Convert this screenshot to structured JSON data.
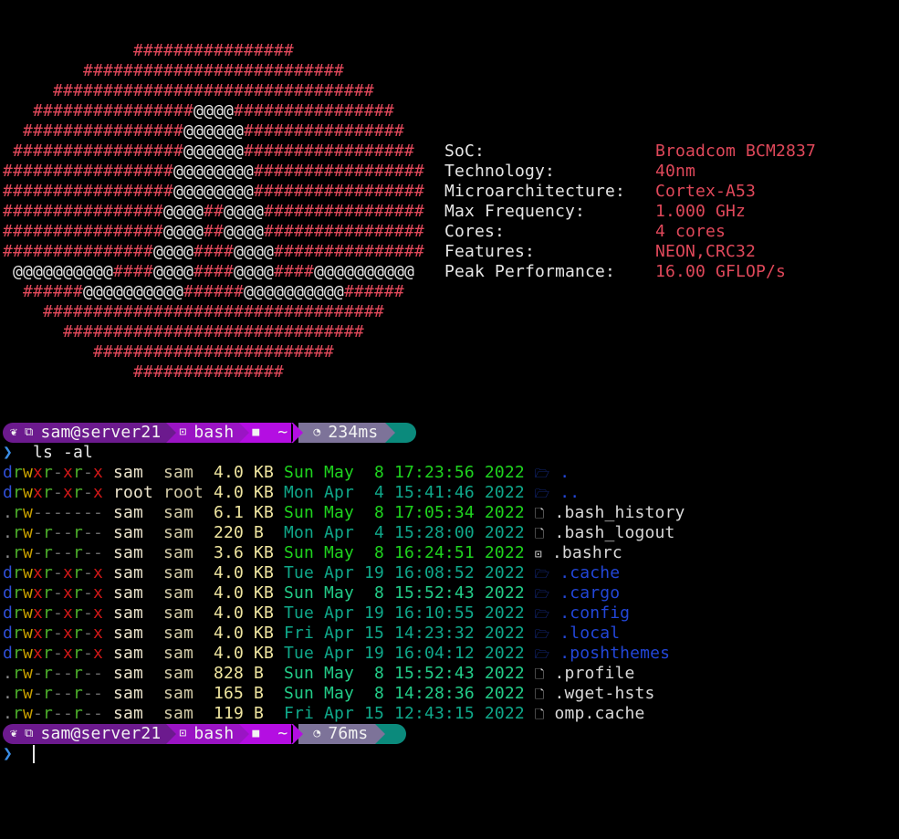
{
  "art": {
    "rows": [
      {
        "indent": 13,
        "parts": [
          [
            "h",
            16
          ]
        ]
      },
      {
        "indent": 8,
        "parts": [
          [
            "h",
            26
          ]
        ]
      },
      {
        "indent": 5,
        "parts": [
          [
            "h",
            32
          ]
        ]
      },
      {
        "indent": 3,
        "parts": [
          [
            "h",
            16
          ],
          [
            "a",
            4
          ],
          [
            "h",
            16
          ]
        ]
      },
      {
        "indent": 2,
        "parts": [
          [
            "h",
            16
          ],
          [
            "a",
            6
          ],
          [
            "h",
            16
          ]
        ]
      },
      {
        "indent": 1,
        "parts": [
          [
            "h",
            17
          ],
          [
            "a",
            6
          ],
          [
            "h",
            17
          ]
        ]
      },
      {
        "indent": 0,
        "parts": [
          [
            "h",
            17
          ],
          [
            "a",
            8
          ],
          [
            "h",
            17
          ]
        ]
      },
      {
        "indent": 0,
        "parts": [
          [
            "h",
            17
          ],
          [
            "a",
            8
          ],
          [
            "h",
            17
          ]
        ]
      },
      {
        "indent": 0,
        "parts": [
          [
            "h",
            16
          ],
          [
            "a",
            4
          ],
          [
            "h",
            2
          ],
          [
            "a",
            4
          ],
          [
            "h",
            16
          ]
        ]
      },
      {
        "indent": 0,
        "parts": [
          [
            "h",
            16
          ],
          [
            "a",
            4
          ],
          [
            "h",
            2
          ],
          [
            "a",
            4
          ],
          [
            "h",
            16
          ]
        ]
      },
      {
        "indent": 0,
        "parts": [
          [
            "h",
            15
          ],
          [
            "a",
            4
          ],
          [
            "h",
            4
          ],
          [
            "a",
            4
          ],
          [
            "h",
            15
          ]
        ]
      },
      {
        "indent": 1,
        "parts": [
          [
            "a",
            10
          ],
          [
            "h",
            4
          ],
          [
            "a",
            4
          ],
          [
            "h",
            4
          ],
          [
            "a",
            4
          ],
          [
            "h",
            4
          ],
          [
            "a",
            10
          ]
        ]
      },
      {
        "indent": 2,
        "parts": [
          [
            "h",
            6
          ],
          [
            "a",
            10
          ],
          [
            "h",
            6
          ],
          [
            "a",
            10
          ],
          [
            "h",
            6
          ]
        ]
      },
      {
        "indent": 4,
        "parts": [
          [
            "h",
            34
          ]
        ]
      },
      {
        "indent": 6,
        "parts": [
          [
            "h",
            30
          ]
        ]
      },
      {
        "indent": 9,
        "parts": [
          [
            "h",
            24
          ]
        ]
      },
      {
        "indent": 13,
        "parts": [
          [
            "h",
            15
          ]
        ]
      }
    ]
  },
  "info": [
    {
      "key": "SoC:",
      "value": "Broadcom BCM2837"
    },
    {
      "key": "Technology:",
      "value": "40nm"
    },
    {
      "key": "Microarchitecture:",
      "value": "Cortex-A53"
    },
    {
      "key": "Max Frequency:",
      "value": "1.000 GHz"
    },
    {
      "key": "Cores:",
      "value": "4 cores"
    },
    {
      "key": "Features:",
      "value": "NEON,CRC32"
    },
    {
      "key": "Peak Performance:",
      "value": "16.00 GFLOP/s"
    }
  ],
  "prompt1": {
    "os_icon": "raspberry-pi-icon",
    "host_icon": "network-icon",
    "user_host": "sam@server21",
    "shell_icon": "terminal-icon",
    "shell": "bash",
    "folder_icon": "folder-icon",
    "path": "~",
    "timer_icon": "stopwatch-icon",
    "duration": "234ms"
  },
  "command": {
    "chevron": "❯",
    "text": "ls -al"
  },
  "listing": [
    {
      "perm": "drwxr-xr-x",
      "user": "sam",
      "group": "sam",
      "size": "4.0 KB",
      "date": "Sun May  8 17:23:56 2022",
      "age": "hour",
      "type": "dir",
      "icon": "folder-open-icon",
      "name": "."
    },
    {
      "perm": "drwxr-xr-x",
      "user": "root",
      "group": "root",
      "size": "4.0 KB",
      "date": "Mon Apr  4 15:41:46 2022",
      "age": "old",
      "type": "dir",
      "icon": "folder-open-icon",
      "name": ".."
    },
    {
      "perm": ".rw-------",
      "user": "sam",
      "group": "sam",
      "size": "6.1 KB",
      "date": "Sun May  8 17:05:34 2022",
      "age": "hour",
      "type": "file",
      "icon": "file-icon",
      "name": ".bash_history"
    },
    {
      "perm": ".rw-r--r--",
      "user": "sam",
      "group": "sam",
      "size": "220 B ",
      "date": "Mon Apr  4 15:28:00 2022",
      "age": "old",
      "type": "file",
      "icon": "file-icon",
      "name": ".bash_logout"
    },
    {
      "perm": ".rw-r--r--",
      "user": "sam",
      "group": "sam",
      "size": "3.6 KB",
      "date": "Sun May  8 16:24:51 2022",
      "age": "hour",
      "type": "file",
      "icon": "terminal-icon",
      "name": ".bashrc"
    },
    {
      "perm": "drwxr-xr-x",
      "user": "sam",
      "group": "sam",
      "size": "4.0 KB",
      "date": "Tue Apr 19 16:08:52 2022",
      "age": "old",
      "type": "dir",
      "icon": "folder-open-icon",
      "name": ".cache"
    },
    {
      "perm": "drwxr-xr-x",
      "user": "sam",
      "group": "sam",
      "size": "4.0 KB",
      "date": "Sun May  8 15:52:43 2022",
      "age": "day",
      "type": "dir",
      "icon": "folder-open-icon",
      "name": ".cargo"
    },
    {
      "perm": "drwxr-xr-x",
      "user": "sam",
      "group": "sam",
      "size": "4.0 KB",
      "date": "Tue Apr 19 16:10:55 2022",
      "age": "old",
      "type": "dir",
      "icon": "folder-open-icon",
      "name": ".config"
    },
    {
      "perm": "drwxr-xr-x",
      "user": "sam",
      "group": "sam",
      "size": "4.0 KB",
      "date": "Fri Apr 15 14:23:32 2022",
      "age": "old",
      "type": "dir",
      "icon": "folder-open-icon",
      "name": ".local"
    },
    {
      "perm": "drwxr-xr-x",
      "user": "sam",
      "group": "sam",
      "size": "4.0 KB",
      "date": "Tue Apr 19 16:04:12 2022",
      "age": "old",
      "type": "dir",
      "icon": "folder-open-icon",
      "name": ".poshthemes"
    },
    {
      "perm": ".rw-r--r--",
      "user": "sam",
      "group": "sam",
      "size": "828 B ",
      "date": "Sun May  8 15:52:43 2022",
      "age": "day",
      "type": "file",
      "icon": "file-icon",
      "name": ".profile"
    },
    {
      "perm": ".rw-r--r--",
      "user": "sam",
      "group": "sam",
      "size": "165 B ",
      "date": "Sun May  8 14:28:36 2022",
      "age": "day",
      "type": "file",
      "icon": "file-icon",
      "name": ".wget-hsts"
    },
    {
      "perm": ".rw-r--r--",
      "user": "sam",
      "group": "sam",
      "size": "119 B ",
      "date": "Fri Apr 15 12:43:15 2022",
      "age": "old",
      "type": "file",
      "icon": "file-icon",
      "name": "omp.cache"
    }
  ],
  "prompt2": {
    "user_host": "sam@server21",
    "shell": "bash",
    "path": "~",
    "duration": "76ms"
  },
  "input": {
    "chevron": "❯",
    "text": ""
  },
  "colors": {
    "accent_red": "#e0485a",
    "segment_user": "#6c1a8e",
    "segment_shell": "#9a14c4",
    "segment_path": "#b40ee2",
    "segment_time": "#7d7399",
    "segment_end": "#0b8a7c",
    "prompt_chevron": "#3a8ee6",
    "dir": "#2246d8"
  }
}
